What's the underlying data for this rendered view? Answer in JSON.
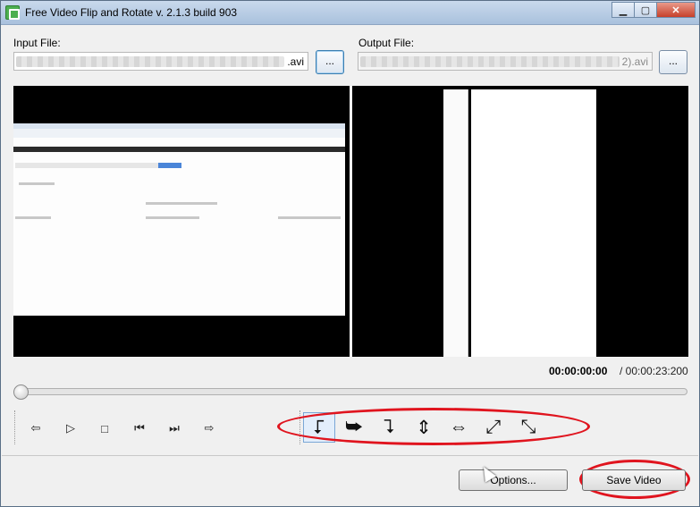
{
  "window": {
    "title": "Free Video Flip and Rotate  v. 2.1.3 build 903",
    "controls": {
      "minimize": "▁",
      "maximize": "▢",
      "close": "✕"
    }
  },
  "input": {
    "label": "Input File:",
    "value_suffix": ".avi",
    "browse_label": "..."
  },
  "output": {
    "label": "Output File:",
    "value_suffix": "2).avi",
    "browse_label": "..."
  },
  "timecode": {
    "current": "00:00:00:00",
    "total": "/  00:00:23:200"
  },
  "playback": {
    "position_fraction": 0,
    "buttons": [
      {
        "name": "prev-frame-icon",
        "glyph": "⇦"
      },
      {
        "name": "play-icon",
        "glyph": "▷"
      },
      {
        "name": "stop-icon",
        "glyph": "□"
      },
      {
        "name": "go-start-icon",
        "glyph": "⏮"
      },
      {
        "name": "go-end-icon",
        "glyph": "⏭"
      },
      {
        "name": "next-frame-icon",
        "glyph": "⇨"
      }
    ]
  },
  "tools": [
    {
      "name": "rotate-90-ccw-icon",
      "glyph": "⮦"
    },
    {
      "name": "rotate-90-cw-icon",
      "glyph": "⮩"
    },
    {
      "name": "rotate-180-icon",
      "glyph": "⮧"
    },
    {
      "name": "flip-vertical-icon",
      "glyph": "⇕"
    },
    {
      "name": "flip-horizontal-icon",
      "glyph": "⇔"
    },
    {
      "name": "transpose-icon",
      "glyph": "⤢"
    },
    {
      "name": "transverse-icon",
      "glyph": "⤡"
    }
  ],
  "selected_tool_index": 0,
  "footer": {
    "options_label": "Options...",
    "save_label": "Save Video"
  },
  "colors": {
    "annotation_red": "#e0141e",
    "selection_blue": "#7aa7d6"
  }
}
